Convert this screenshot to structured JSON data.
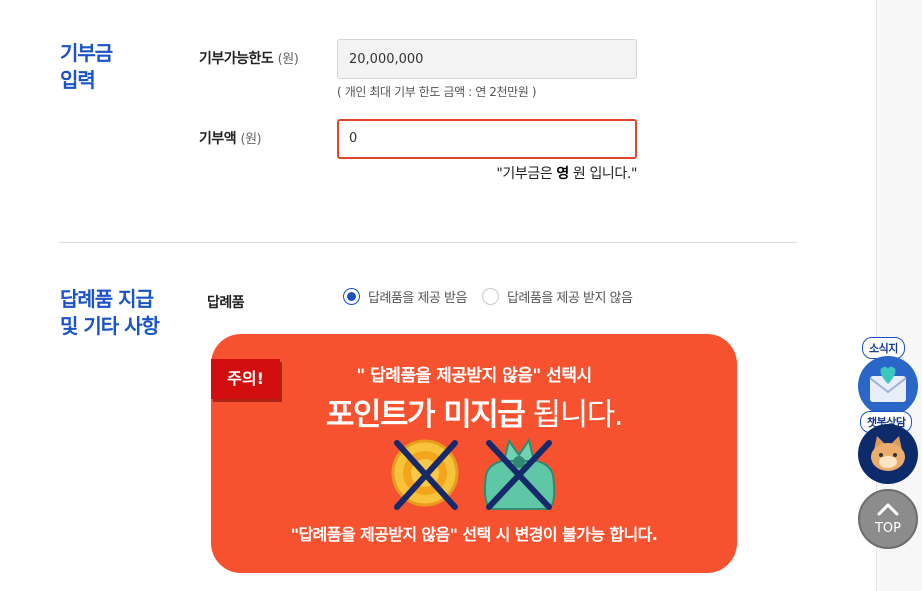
{
  "donation_section": {
    "title_line1": "기부금",
    "title_line2": "입력",
    "limit_label": "기부가능한도",
    "limit_unit": "(원)",
    "limit_value": "20,000,000",
    "limit_hint": "( 개인 최대 기부 한도 금액 : 연 2천만원 )",
    "amount_label": "기부액",
    "amount_unit": "(원)",
    "amount_value": "0",
    "amount_text_prefix": "\"기부금은 ",
    "amount_text_value": "영",
    "amount_text_suffix": " 원 입니다.\""
  },
  "gift_section": {
    "title_line1": "답례품 지급",
    "title_line2": "및 기타 사항",
    "gift_label": "답례품",
    "options": [
      {
        "label": "답례품을 제공 받음",
        "checked": true
      },
      {
        "label": "답례품을 제공 받지 않음",
        "checked": false
      }
    ]
  },
  "notice": {
    "badge": "주의!",
    "line1": "\" 답례품을 제공받지 않음\" 선택시",
    "line2_bold": "포인트가 미지급",
    "line2_light": " 됩니다.",
    "line3": "\"답례품을 제공받지 않음\" 선택 시 변경이 불가능 합니다.",
    "icons": [
      "coin-icon",
      "gift-bundle-icon"
    ]
  },
  "quick_menu": {
    "news_label": "소식지",
    "chatbot_label": "챗봇상담",
    "top_label": "TOP"
  },
  "colors": {
    "accent_blue": "#1a52c8",
    "notice_orange": "#f7522f",
    "badge_red": "#d10d0d",
    "input_focus": "#e0452a"
  }
}
